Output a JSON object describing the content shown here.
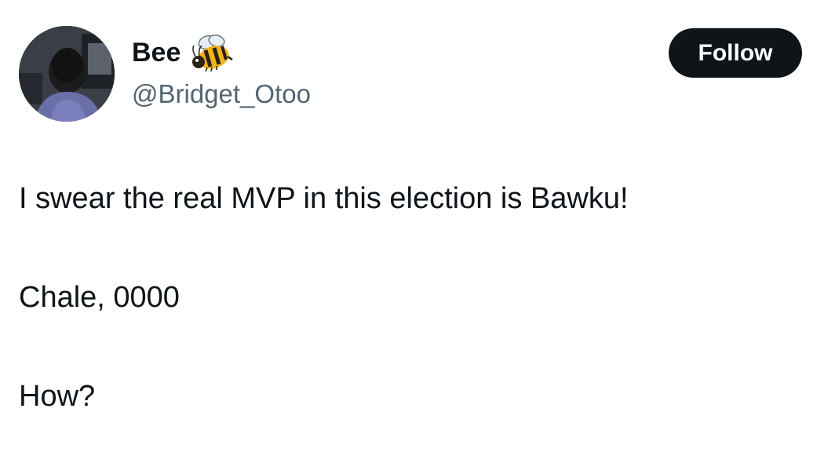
{
  "author": {
    "display_name": "Bee",
    "handle": "@Bridget_Otoo",
    "name_emoji": "bee-icon"
  },
  "actions": {
    "follow_label": "Follow"
  },
  "tweet": {
    "lines": [
      "I swear the real MVP in this election is Bawku!",
      "Chale, 0000",
      "How?"
    ]
  },
  "colors": {
    "text_primary": "#0f1419",
    "text_secondary": "#536471",
    "follow_bg": "#0f1419",
    "follow_text": "#ffffff",
    "background": "#ffffff"
  }
}
